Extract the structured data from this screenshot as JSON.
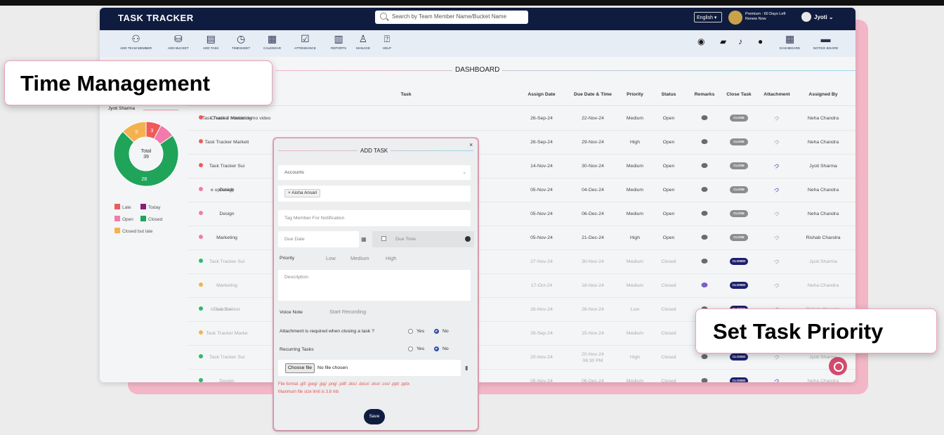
{
  "app": {
    "brand": "TASK TRACKER",
    "search_placeholder": "Search by Team Member Name/Bucket Name",
    "language": "English",
    "premium_line1": "Premium : 60 Days Left",
    "premium_line2": "Renew Now",
    "user_name": "Jyoti"
  },
  "toolbar": {
    "items": [
      {
        "label": "ADD TEAM MEMBER",
        "icon": "add-user-icon"
      },
      {
        "label": "ADD BUCKET",
        "icon": "bucket-icon"
      },
      {
        "label": "ADD TASK",
        "icon": "clipboard-icon"
      },
      {
        "label": "TIMESHEET",
        "icon": "timesheet-icon"
      },
      {
        "label": "CALENDAR",
        "icon": "calendar-icon"
      },
      {
        "label": "ATTENDANCE",
        "icon": "attendance-icon"
      },
      {
        "label": "REPORTS",
        "icon": "reports-icon"
      },
      {
        "label": "MANAGE",
        "icon": "manage-icon"
      },
      {
        "label": "HELP",
        "icon": "help-icon"
      }
    ],
    "right": {
      "dashboard": "DASHBOARD",
      "notice_board": "NOTICE BOARD"
    }
  },
  "dashboard": {
    "title": "DASHBOARD",
    "member": "Jyoti Sharma",
    "chart": {
      "total_label": "Total",
      "total_value": "39",
      "slices": [
        {
          "label": "Late",
          "value": "3",
          "color": "#f05a5a"
        },
        {
          "label": "Open",
          "value": "",
          "color": "#f27bab"
        },
        {
          "label": "Closed",
          "value": "28",
          "color": "#1fa45a"
        },
        {
          "label": "Closed but late",
          "value": "5",
          "color": "#f4b24f"
        }
      ]
    },
    "legend": {
      "late": "Late",
      "today": "Today",
      "open": "Open",
      "closed": "Closed",
      "closed_late": "Closed but late"
    },
    "columns": {
      "task": "Task",
      "assign_date": "Assign Date",
      "due": "Due Date & Time",
      "priority": "Priority",
      "status": "Status",
      "remarks": "Remarks",
      "close_task": "Close Task",
      "attachment": "Attachment",
      "assigned_by": "Assigned By"
    },
    "rows": [
      {
        "dot": "#f05a5a",
        "bucket": "Task Tracker Marketing",
        "task": "Create 2 minute demo video",
        "assign": "26-Sep-24",
        "due": "22-Nov-24",
        "priority": "Medium",
        "status": "Open",
        "btn": "CLOSE",
        "by": "Neha Chandra"
      },
      {
        "dot": "#f05a5a",
        "bucket": "Task Tracker Marketi",
        "task": "",
        "assign": "26-Sep-24",
        "due": "29-Nov-24",
        "priority": "High",
        "status": "Open",
        "btn": "CLOSE",
        "by": "Neha Chandra"
      },
      {
        "dot": "#f05a5a",
        "bucket": "Task Tracker Sui",
        "task": "",
        "assign": "14-Nov-24",
        "due": "30-Nov-24",
        "priority": "Medium",
        "status": "Open",
        "btn": "CLOSE",
        "by": "Jyoti Sharma"
      },
      {
        "dot": "#f27bab",
        "bucket": "Design",
        "task": "e updated)",
        "assign": "05-Nov-24",
        "due": "04-Dec-24",
        "priority": "Medium",
        "status": "Open",
        "btn": "CLOSE",
        "by": "Neha Chandra"
      },
      {
        "dot": "#f27bab",
        "bucket": "Design",
        "task": "",
        "assign": "05-Nov-24",
        "due": "06-Dec-24",
        "priority": "Medium",
        "status": "Open",
        "btn": "CLOSE",
        "by": "Neha Chandra"
      },
      {
        "dot": "#f27bab",
        "bucket": "Marketing",
        "task": "",
        "assign": "05-Nov-24",
        "due": "21-Dec-24",
        "priority": "High",
        "status": "Open",
        "btn": "CLOSE",
        "by": "Rishab Chandra"
      },
      {
        "dot": "#2fb86a",
        "bucket": "Task Tracker Sui",
        "task": "",
        "assign": "27-Nov-24",
        "due": "30-Nov-24",
        "priority": "Medium",
        "status": "Closed",
        "btn": "CLOSED",
        "by": "Jyoti Sharma"
      },
      {
        "dot": "#f4b24f",
        "bucket": "Marketing",
        "task": "",
        "assign": "17-Oct-24",
        "due": "18-Nov-24",
        "priority": "Medium",
        "status": "Closed",
        "btn": "CLOSED",
        "by": "Neha Chandra"
      },
      {
        "dot": "#2fb86a",
        "bucket": "Task Tracker",
        "task": "ts Account",
        "assign": "26-Nov-24",
        "due": "26-Nov-24",
        "priority": "Low",
        "status": "Closed",
        "btn": "CLOSED",
        "by": "Rishab Chandra"
      },
      {
        "dot": "#f4b24f",
        "bucket": "Task Tracker Marke",
        "task": "",
        "assign": "26-Sep-24",
        "due": "15-Nov-24",
        "priority": "Medium",
        "status": "Closed",
        "btn": "",
        "by": ""
      },
      {
        "dot": "#2fb86a",
        "bucket": "Task Tracker Sui",
        "task": "",
        "assign": "20-Nov-24",
        "due": "20-Nov-24",
        "due2": "06:30 PM",
        "priority": "High",
        "status": "Closed",
        "btn": "CLOSED",
        "by": "Jyoti Sharma"
      },
      {
        "dot": "#2fb86a",
        "bucket": "Design",
        "task": "",
        "assign": "05-Nov-24",
        "due": "06-Dec-24",
        "priority": "Medium",
        "status": "Closed",
        "btn": "CLOSED",
        "by": "Neha Chandra"
      }
    ]
  },
  "modal": {
    "title": "ADD TASK",
    "close": "×",
    "bucket_value": "Accounts",
    "assignee_chip": "× Aisha Ansari",
    "tag_placeholder": "Tag Member For Notification",
    "due_date_placeholder": "Due Date",
    "due_time_label": "Due Time",
    "priority_label": "Priority",
    "priority_options": [
      "Low",
      "Medium",
      "High"
    ],
    "description_placeholder": "Description",
    "voice_note_label": "Voice Note",
    "start_recording": "Start Recording",
    "attachment_question": "Attachment is required when closing a task ?",
    "recurring_label": "Recurring Tasks",
    "yes": "Yes",
    "no": "No",
    "choose_file": "Choose file",
    "no_file": "No file chosen",
    "file_format_hint": "File format .gif/ .jpeg/ .jpg/ .png/ .pdf/ .doc/ .docx/ .xlsx/ .csv/ .ppt/ .pptx",
    "file_size_hint": "Maximum file size limit is 3.8 mb",
    "save": "Save"
  },
  "callouts": {
    "left": "Time Management",
    "right": "Set Task Priority"
  },
  "colors": {
    "navy": "#0f1c3f",
    "closed_badge": "#1c1f6b",
    "close_badge": "#8d8d8d",
    "accent_pink": "#f2b6c6"
  }
}
